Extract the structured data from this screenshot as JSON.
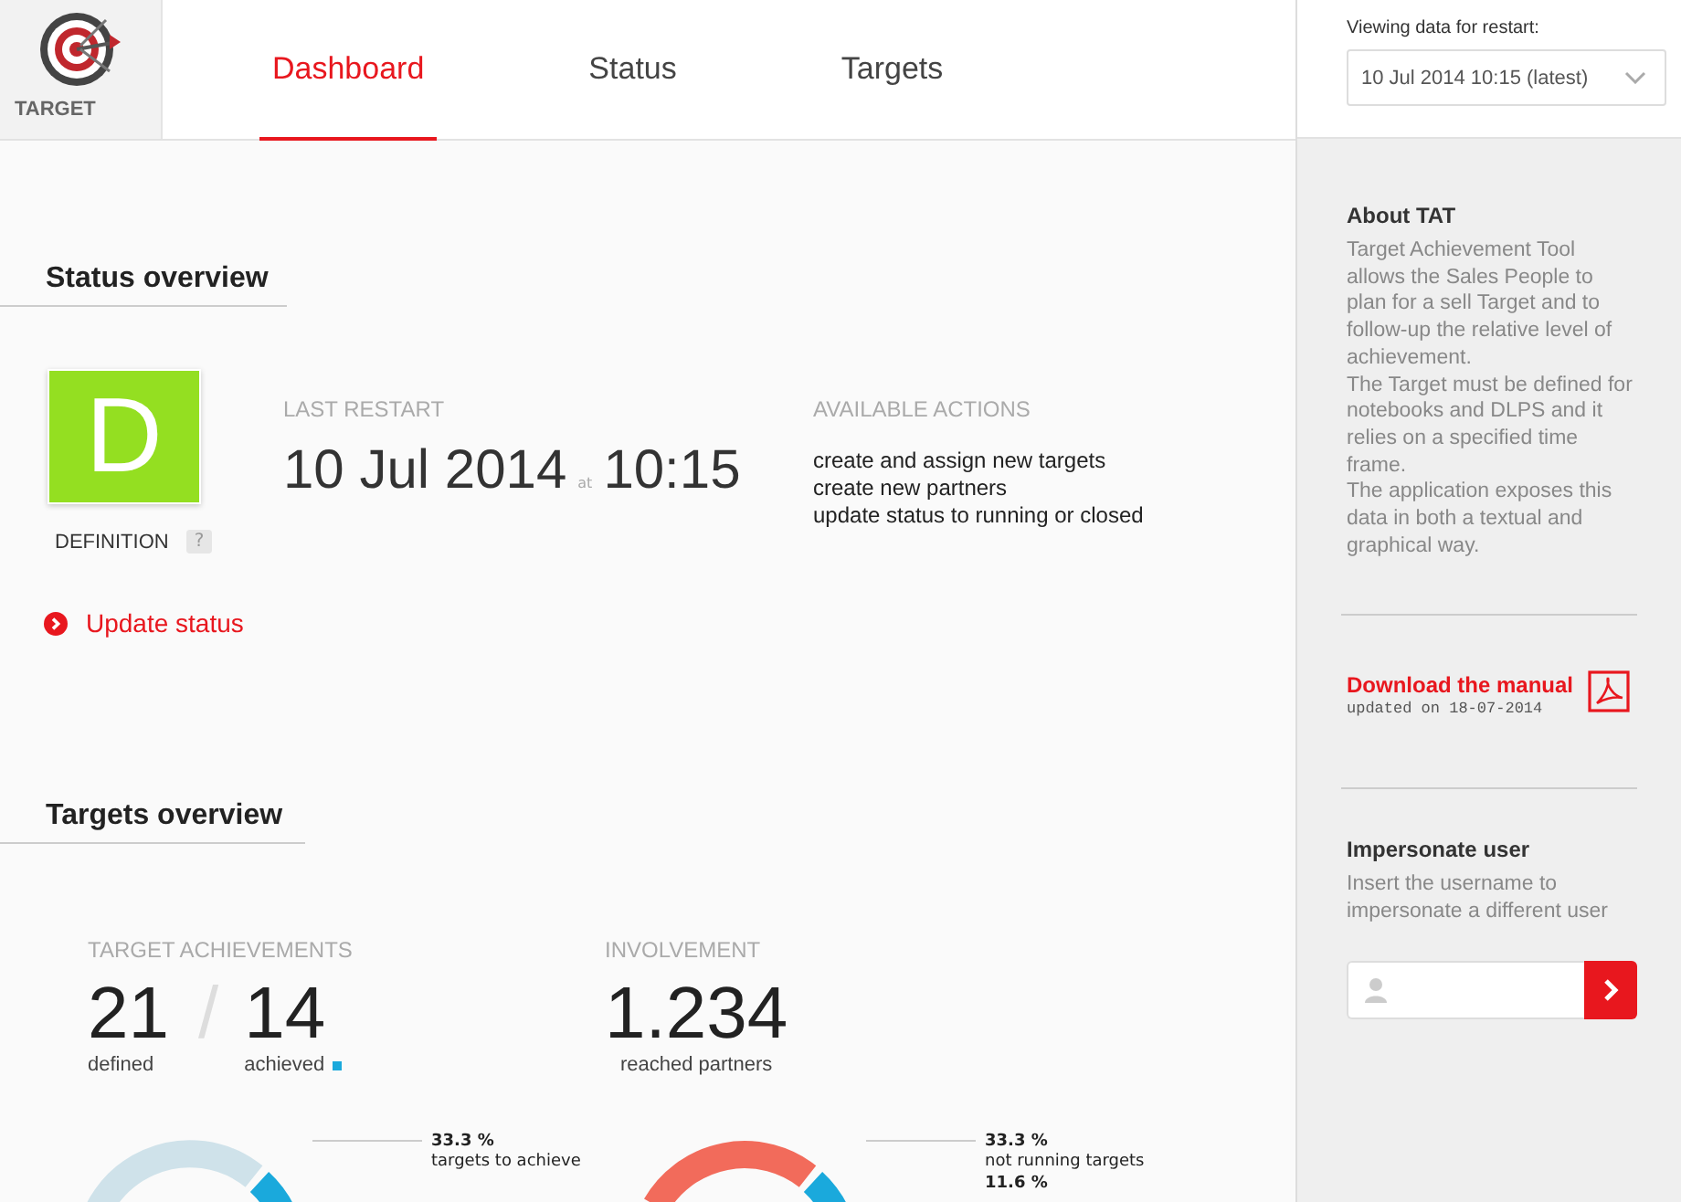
{
  "app": {
    "logo_text": "TARGET"
  },
  "tabs": [
    {
      "label": "Dashboard",
      "selected": true
    },
    {
      "label": "Status",
      "selected": false
    },
    {
      "label": "Targets",
      "selected": false
    }
  ],
  "restart_picker": {
    "label": "Viewing data for restart:",
    "value": "10 Jul 2014 10:15 (latest)"
  },
  "status_overview": {
    "title": "Status overview",
    "status_badge": {
      "letter": "D",
      "label": "DEFINITION",
      "help": "?"
    },
    "last_restart": {
      "label": "LAST RESTART",
      "date": "10 Jul 2014",
      "at": "at",
      "time": "10:15"
    },
    "available_actions": {
      "label": "AVAILABLE ACTIONS",
      "items": [
        "create and assign new targets",
        "create new partners",
        "update status to running or closed"
      ]
    },
    "update_link": "Update status"
  },
  "targets_overview": {
    "title": "Targets overview",
    "achievements": {
      "label": "TARGET ACHIEVEMENTS",
      "defined": "21",
      "defined_label": "defined",
      "separator": "/",
      "achieved": "14",
      "achieved_label": "achieved"
    },
    "involvement": {
      "label": "INVOLVEMENT",
      "value": "1.234",
      "caption": "reached partners"
    },
    "donuts": [
      {
        "callouts": [
          {
            "value": "33.3 %",
            "label": "targets to achieve"
          }
        ]
      },
      {
        "callouts": [
          {
            "value": "33.3 %",
            "label": "not running targets"
          },
          {
            "value": "11.6 %"
          }
        ]
      }
    ]
  },
  "sidebar": {
    "about": {
      "title": "About TAT",
      "paragraphs": [
        "Target Achievement Tool allows the Sales People to plan for a sell Target and to follow-up the relative level of achievement.",
        "The Target must be defined for notebooks and DLPS and it relies on a specified time frame.",
        "The application exposes this data in both a textual and graphical way."
      ]
    },
    "manual": {
      "link": "Download the manual",
      "updated": "updated on 18-07-2014"
    },
    "impersonate": {
      "title": "Impersonate user",
      "text": "Insert the username to impersonate a different user"
    }
  }
}
